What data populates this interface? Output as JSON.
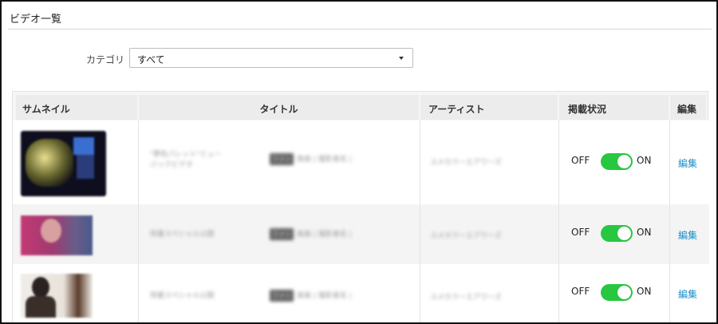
{
  "page": {
    "title": "ビデオ一覧"
  },
  "filter": {
    "label": "カテゴリ",
    "selected": "すべて"
  },
  "table": {
    "headers": {
      "thumbnail": "サムネイル",
      "title": "タイトル",
      "artist": "アーティスト",
      "published": "掲載状況",
      "edit": "編集"
    },
    "rows": [
      {
        "title_blur": "\"夢色パレット\"ミュージックビデオ",
        "tag": "ファン",
        "tag_text": "楽曲 | 撮影者名 |",
        "artist_blur": "ユメカラーエアワーズ",
        "toggle_off": "OFF",
        "toggle_on": "ON",
        "published": true,
        "edit": "編集"
      },
      {
        "title_blur": "特番スペシャル公開",
        "tag": "ファン",
        "tag_text": "楽曲 | 撮影者名 |",
        "artist_blur": "ユメカラーエアワーズ",
        "toggle_off": "OFF",
        "toggle_on": "ON",
        "published": true,
        "edit": "編集"
      },
      {
        "title_blur": "特番スペシャル公開",
        "tag": "ファン",
        "tag_text": "楽曲 | 撮影者名 |",
        "artist_blur": "ユメカラーエアワーズ",
        "toggle_off": "OFF",
        "toggle_on": "ON",
        "published": true,
        "edit": "編集"
      }
    ]
  },
  "colors": {
    "toggle_on": "#27c840",
    "link": "#1a8fc9",
    "header_bg": "#ececec"
  }
}
